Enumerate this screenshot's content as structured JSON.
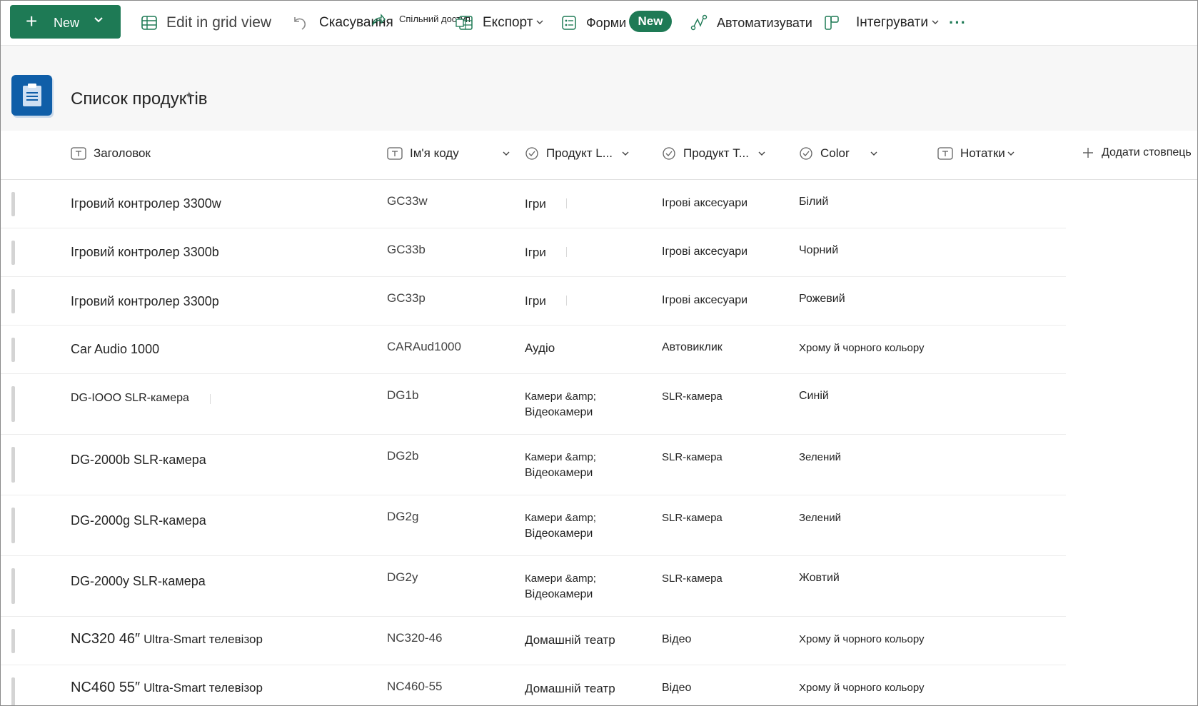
{
  "toolbar": {
    "new_label": "New",
    "edit_grid_label": "Edit in grid view",
    "undo_label": "Скасування",
    "share_label": "Спільний доступ",
    "export_label": "Експорт",
    "forms_label": "Форми",
    "forms_badge": "New",
    "automate_label": "Автоматизувати",
    "integrate_label": "Інтегрувати",
    "more_label": "···"
  },
  "page": {
    "title": "Список продуктів"
  },
  "columns": {
    "title": "Заголовок",
    "code": "Ім'я коду",
    "product_line": "Продукт L...",
    "product_type": "Продукт Т...",
    "color": "Color",
    "notes": "Нотатки",
    "add_column": "Додати стовпець"
  },
  "rows": [
    {
      "title": "Ігровий контролер 3300w",
      "code": "GC33w",
      "line1": "Ігри",
      "line2": "",
      "type": "Ігрові аксесуари",
      "color": "Білий"
    },
    {
      "title": "Ігровий контролер 3300b",
      "code": "GC33b",
      "line1": "Ігри",
      "line2": "",
      "type": "Ігрові аксесуари",
      "color": "Чорний"
    },
    {
      "title": "Ігровий контролер 3300p",
      "code": "GC33p",
      "line1": "Ігри",
      "line2": "",
      "type": "Ігрові аксесуари",
      "color": "Рожевий"
    },
    {
      "title": "Car Audio 1000",
      "code": "CARAud1000",
      "line1": "Аудіо",
      "line2": "",
      "type": "Автовиклик",
      "color": "Хрому й чорного кольору"
    },
    {
      "title": "DG-IOOO SLR-камера",
      "code": "DG1b",
      "line1": "Камери &amp;",
      "line2": "Відеокамери",
      "type": "SLR-камера",
      "color": "Синій"
    },
    {
      "title": "DG-2000b SLR-камера",
      "code": "DG2b",
      "line1": "Камери &amp;",
      "line2": "Відеокамери",
      "type": "SLR-камера",
      "color": "Зелений"
    },
    {
      "title": "DG-2000g SLR-камера",
      "code": "DG2g",
      "line1": "Камери &amp;",
      "line2": "Відеокамери",
      "type": "SLR-камера",
      "color": "Зелений"
    },
    {
      "title": "DG-2000y SLR-камера",
      "code": "DG2y",
      "line1": "Камери &amp;",
      "line2": "Відеокамери",
      "type": "SLR-камера",
      "color": "Жовтий"
    },
    {
      "title_big": "NC320 46″",
      "title_small": "Ultra-Smart телевізор",
      "code": "NC320-46",
      "line1": "Домашній театр",
      "line2": "",
      "type": "Відео",
      "color": "Хрому й чорного кольору"
    },
    {
      "title_big": "NC460 55″",
      "title_small": "Ultra-Smart телевізор",
      "code": "NC460-55",
      "line1": "Домашній театр",
      "line2": "",
      "type": "Відео",
      "color": "Хрому й чорного кольору"
    }
  ],
  "colors": {
    "accent": "#1e7a55",
    "app_icon": "#0f5ea8"
  }
}
